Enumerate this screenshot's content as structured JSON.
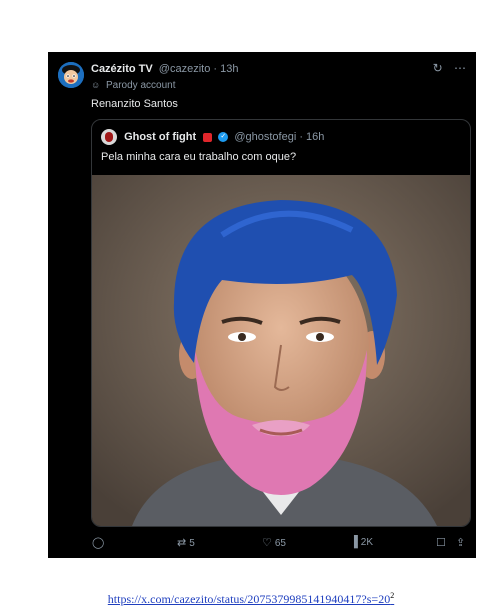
{
  "tweet": {
    "author_name": "Cazézito TV",
    "author_meta": "@cazezito · 13h",
    "label": "Parody account",
    "text": "Renanzito Santos",
    "icons": [
      "grok-icon",
      "more-icon"
    ]
  },
  "quote": {
    "author_name": "Ghost of fight",
    "author_meta": "@ghostofegi · 16h",
    "text": "Pela minha cara eu trabalho com oque?"
  },
  "actions": {
    "retweets": "5",
    "likes": "65",
    "views": "2K"
  },
  "footer": {
    "link": "https://x.com/cazezito/status/2075379985141940417?s=20",
    "footnote": "2"
  },
  "colors": {
    "background": "#000000",
    "text": "#e7e9ea",
    "muted": "#8b98a5",
    "verified": "#1d9bf0",
    "hair": "#1f4fb0",
    "beard": "#e06aa8"
  }
}
